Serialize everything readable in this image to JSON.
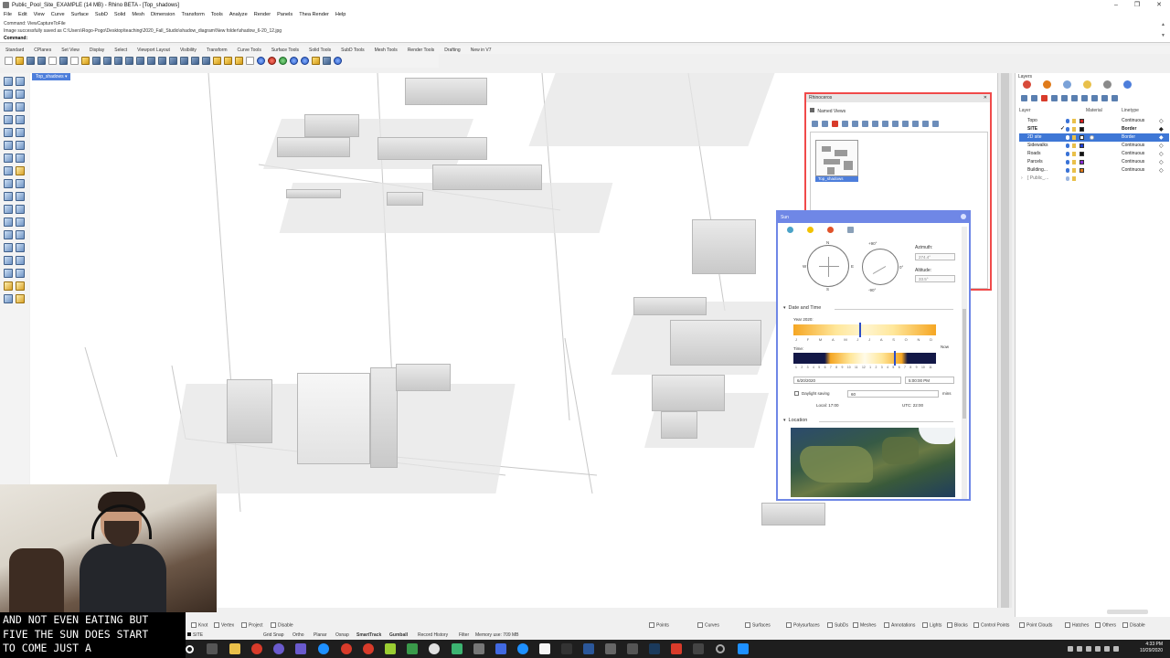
{
  "window": {
    "title": "Public_Pool_Site_EXAMPLE (14 MB) - Rhino BETA - [Top_shadows]",
    "controls": [
      "–",
      "❐",
      "✕"
    ]
  },
  "menu": [
    "File",
    "Edit",
    "View",
    "Curve",
    "Surface",
    "SubD",
    "Solid",
    "Mesh",
    "Dimension",
    "Transform",
    "Tools",
    "Analyze",
    "Render",
    "Panels",
    "Thea Render",
    "Help"
  ],
  "command_area": {
    "history_1": "Command: ViewCaptureToFile",
    "history_2": "Image successfully saved as C:\\Users\\Rogo-Pogo\\Desktop\\teaching\\2020_Fall_Studio\\shadow_diagram\\New folder\\shadow_6-20_12.jpg",
    "prompt_label": "Command:"
  },
  "toolbar_tabs": [
    "Standard",
    "CPlanes",
    "Set View",
    "Display",
    "Select",
    "Viewport Layout",
    "Visibility",
    "Transform",
    "Curve Tools",
    "Surface Tools",
    "Solid Tools",
    "SubD Tools",
    "Mesh Tools",
    "Render Tools",
    "Drafting",
    "New in V7"
  ],
  "viewport": {
    "tab_label": "Top_shadows ▾"
  },
  "layers_panel": {
    "title": "Layers",
    "columns": {
      "layer": "Layer",
      "material": "Material",
      "linetype": "Linetype"
    },
    "rows": [
      {
        "name": "Topo",
        "color": "#d62020",
        "linetype": "Continuous",
        "current": false,
        "selected": false
      },
      {
        "name": "SITE",
        "color": "#111111",
        "linetype": "Border",
        "current": true,
        "selected": false,
        "bold": true
      },
      {
        "name": "2D site",
        "color": "#ffffff",
        "linetype": "Border",
        "current": false,
        "selected": true
      },
      {
        "name": "Sidewalks",
        "color": "#1f3fd6",
        "linetype": "Continuous",
        "current": false,
        "selected": false
      },
      {
        "name": "Roads",
        "color": "#111111",
        "linetype": "Continuous",
        "current": false,
        "selected": false
      },
      {
        "name": "Parcels",
        "color": "#8a2bd6",
        "linetype": "Continuous",
        "current": false,
        "selected": false
      },
      {
        "name": "Building...",
        "color": "#e07b1a",
        "linetype": "Continuous",
        "current": false,
        "selected": false
      },
      {
        "name": "[ Public_...",
        "color": "",
        "linetype": "",
        "current": false,
        "selected": false
      }
    ]
  },
  "named_views_panel": {
    "title": "Rhinoceros",
    "subtitle": "Named Views",
    "views": [
      {
        "label": "Top_shadows"
      }
    ]
  },
  "sun_panel": {
    "title": "Sun",
    "compass_labels": {
      "n": "N",
      "s": "S",
      "e": "E",
      "w": "W"
    },
    "altitude_labels": {
      "top": "+90°",
      "bottom": "-90°",
      "side": "0°"
    },
    "azimuth_label": "Azimuth:",
    "azimuth_value": "274.4°",
    "altitude_label": "Altitude:",
    "altitude_value": "33.5°",
    "date_time_section": "Date and Time",
    "year_label": "Year 2020:",
    "months": [
      "J",
      "F",
      "M",
      "A",
      "M",
      "J",
      "J",
      "A",
      "S",
      "O",
      "N",
      "D"
    ],
    "time_label": "Time:",
    "hours": [
      "1",
      "2",
      "3",
      "4",
      "5",
      "6",
      "7",
      "8",
      "9",
      "10",
      "11",
      "12",
      "1",
      "2",
      "3",
      "4",
      "5",
      "6",
      "7",
      "8",
      "9",
      "10",
      "11"
    ],
    "now_label": "Now",
    "date_value": "6/20/2020",
    "time_value": "5:00:00 PM",
    "daylight_label": "Daylight saving",
    "daylight_minutes": "60",
    "mins_label": "mins",
    "local_label": "Local: 17:00",
    "utc_label": "UTC: 22:00",
    "location_section": "Location",
    "year_marker_fraction": 0.47,
    "time_marker_fraction": 0.71
  },
  "captions": {
    "line1": "AND NOT EVEN EATING BUT",
    "line2": "FIVE THE SUN DOES START",
    "line3": "TO COME JUST A"
  },
  "osnap_row": {
    "left": [
      "Knot",
      "Vertex",
      "Project",
      "Disable"
    ],
    "right": [
      "Points",
      "Curves",
      "Surfaces",
      "Polysurfaces",
      "SubDs",
      "Meshes",
      "Annotations",
      "Lights",
      "Blocks",
      "Control Points",
      "Point Clouds",
      "Hatches",
      "Others",
      "Disable"
    ]
  },
  "status_row": {
    "layer": "SITE",
    "items": [
      "Grid Snap",
      "Ortho",
      "Planar",
      "Osnap",
      "SmartTrack",
      "Gumball",
      "Record History",
      "Filter"
    ],
    "memory": "Memory use: 709 MB"
  },
  "taskbar": {
    "time": "4:33 PM",
    "date": "10/29/2020"
  },
  "colors": {
    "accent": "#4d7edb",
    "sun_panel_border": "#6f87e6",
    "named_views_border": "#f04a4a"
  }
}
